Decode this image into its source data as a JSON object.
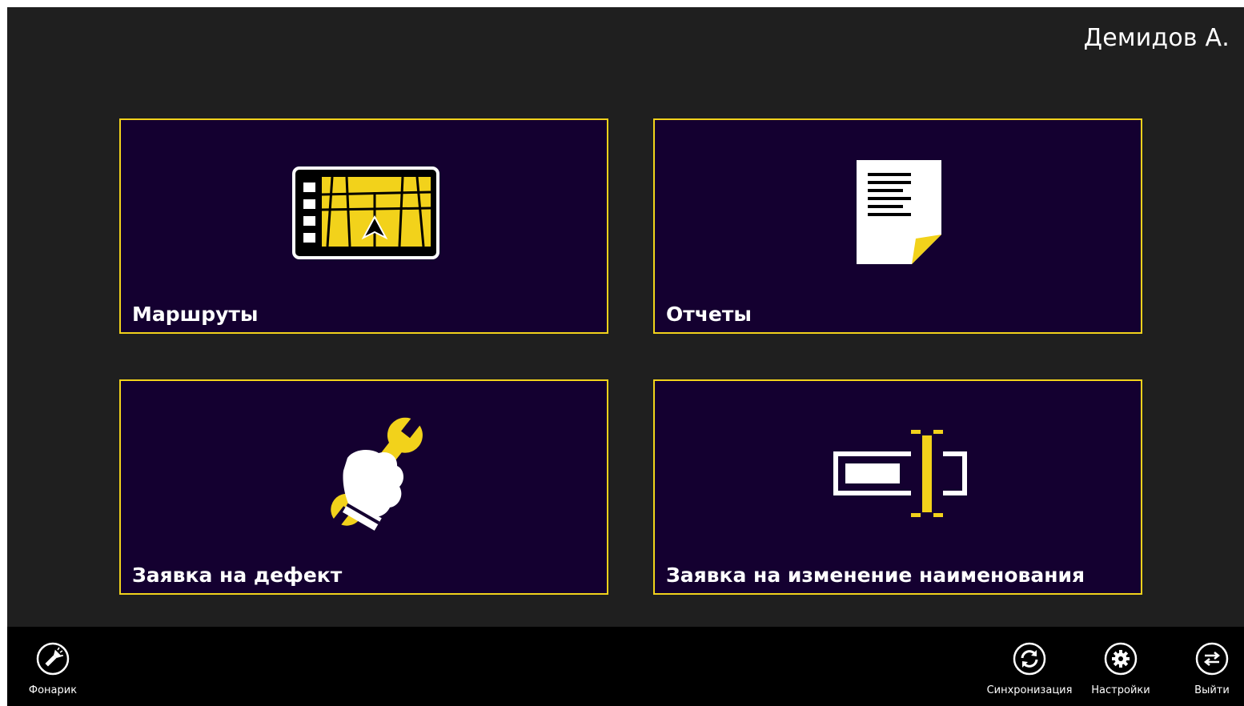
{
  "header": {
    "user_name": "Демидов А."
  },
  "tiles": [
    {
      "label": "Маршруты",
      "icon": "navigator-map-icon"
    },
    {
      "label": "Отчеты",
      "icon": "report-document-icon"
    },
    {
      "label": "Заявка на дефект",
      "icon": "hand-wrench-icon"
    },
    {
      "label": "Заявка на изменение наименования",
      "icon": "text-rename-icon"
    }
  ],
  "appbar": {
    "left": [
      {
        "label": "Фонарик",
        "icon": "flashlight-icon"
      }
    ],
    "right": [
      {
        "label": "Синхронизация",
        "icon": "sync-icon"
      },
      {
        "label": "Настройки",
        "icon": "gear-icon"
      },
      {
        "label": "Выйти",
        "icon": "exit-arrows-icon"
      }
    ]
  },
  "colors": {
    "background": "#1f1f1f",
    "tile_background": "#140030",
    "tile_border": "#f2d21b",
    "accent_yellow": "#f2d21b",
    "appbar_background": "#000000",
    "text": "#ffffff"
  }
}
